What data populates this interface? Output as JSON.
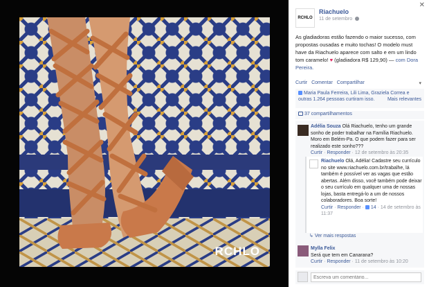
{
  "photo": {
    "watermark": "RCHLO"
  },
  "post": {
    "page_name": "Riachuelo",
    "date": "11 de setembro",
    "logo_text": "RCHLO",
    "text_main": "As gladiadoras estão fazendo o maior sucesso, com propostas ousadas e muito tochas! O modelo must have da Riachuelo aparece com salto e em um lindo tom caramelo!",
    "text_tail": "(gladiadora R$ 129,90) —",
    "text_with": "com Dora Pereira."
  },
  "actions": {
    "like": "Curtir",
    "comment": "Comentar",
    "share": "Compartilhar"
  },
  "likes": {
    "names": "Maria Paula Ferreira, Lili Lima, Graziela Correa e outras 1.264 pessoas curtiram isso.",
    "most_relevant": "Mais relevantes"
  },
  "shares": {
    "label": "37 compartilhamentos"
  },
  "comments": [
    {
      "author": "Adélia Souza",
      "text": "Olá Riachuelo, tenho um grande sonho de poder trabalhar na Família Riachuelo. Moro em Belém-Pa. O que podem fazer para ser realizado este sonho???",
      "like": "Curtir",
      "reply": "Responder",
      "time": "12 de setembro às 20:35"
    },
    {
      "author": "Riachuelo",
      "text": "Olá, Adélia! Cadastre seu currículo no site www.riachuelo.com.br/trabalhe, lá também é possível ver as vagas que estão abertas. Além disso, você também pode deixar o seu currículo em qualquer uma de nossas lojas, basta entregá-lo a um de nossos colaboradores. Boa sorte!",
      "like": "Curtir",
      "reply": "Responder",
      "likes_count": "14",
      "time": "14 de setembro às 11:37"
    },
    {
      "author": "Mylla Felix",
      "text": "Será que tem em Canarana?",
      "like": "Curtir",
      "reply": "Responder",
      "time": "11 de setembro às 10:20"
    }
  ],
  "more_replies": "Ver mais respostas",
  "write_comment": {
    "placeholder": "Escreva um comentário..."
  }
}
